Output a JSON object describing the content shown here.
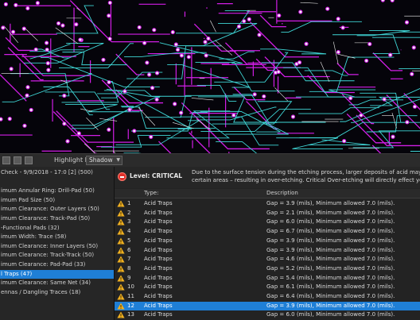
{
  "colors": {
    "accent_selection": "#1f7fd6",
    "critical": "#e0302a",
    "warning": "#f0b020",
    "trace_magenta": "#d21ee6",
    "trace_cyan": "#3fd6d6",
    "trace_white": "#f2f2f2",
    "board_background": "#05040a"
  },
  "pcb_view": {
    "description_icon": "pcb-layout-canvas"
  },
  "toolbar": {
    "icons": [
      "document-icon",
      "grid-icon",
      "list-icon"
    ],
    "highlight_mode_label": "Highlight Mode:",
    "highlight_mode_value": "Shadow"
  },
  "left_panel": {
    "items": [
      {
        "label": "Check - 9/9/2018 - 17:0 [2] (500)",
        "selected": false
      },
      {
        "label": "",
        "selected": false
      },
      {
        "label": "imum Annular Ring: Drill-Pad (50)",
        "selected": false
      },
      {
        "label": "imum Pad Size (50)",
        "selected": false
      },
      {
        "label": "imum Clearance: Outer Layers (50)",
        "selected": false
      },
      {
        "label": "imum Clearance: Track-Pad (50)",
        "selected": false
      },
      {
        "label": "-Functional Pads (32)",
        "selected": false
      },
      {
        "label": "imum Width: Trace (58)",
        "selected": false
      },
      {
        "label": "imum Clearance: Inner Layers (50)",
        "selected": false
      },
      {
        "label": "imum Clearance: Track-Track (50)",
        "selected": false
      },
      {
        "label": "imum Clearance: Pad-Pad (33)",
        "selected": false
      },
      {
        "label": "l Traps (47)",
        "selected": true
      },
      {
        "label": "imum Clearance: Same Net (34)",
        "selected": false
      },
      {
        "label": "ennas / Dangling Traces (18)",
        "selected": false
      }
    ]
  },
  "level": {
    "text": "Level: CRITICAL",
    "description_line1": "Due to the surface tension during the etching process, larger deposits of acid may get",
    "description_line2": "certain areas – resulting in over-etching. Critical   Over-etching will directly effect you"
  },
  "table": {
    "col_type": "Type:",
    "col_desc": "Description",
    "rows": [
      {
        "num": "1",
        "type": "Acid Traps",
        "desc": "Gap = 3.9 (mils), Minimum allowed 7.0 (mils).",
        "selected": false
      },
      {
        "num": "2",
        "type": "Acid Traps",
        "desc": "Gap = 2.1 (mils), Minimum allowed 7.0 (mils).",
        "selected": false
      },
      {
        "num": "3",
        "type": "Acid Traps",
        "desc": "Gap = 6.0 (mils), Minimum allowed 7.0 (mils).",
        "selected": false
      },
      {
        "num": "4",
        "type": "Acid Traps",
        "desc": "Gap = 6.7 (mils), Minimum allowed 7.0 (mils).",
        "selected": false
      },
      {
        "num": "5",
        "type": "Acid Traps",
        "desc": "Gap = 3.9 (mils), Minimum allowed 7.0 (mils).",
        "selected": false
      },
      {
        "num": "6",
        "type": "Acid Traps",
        "desc": "Gap = 3.9 (mils), Minimum allowed 7.0 (mils).",
        "selected": false
      },
      {
        "num": "7",
        "type": "Acid Traps",
        "desc": "Gap = 4.6 (mils), Minimum allowed 7.0 (mils).",
        "selected": false
      },
      {
        "num": "8",
        "type": "Acid Traps",
        "desc": "Gap = 5.2 (mils), Minimum allowed 7.0 (mils).",
        "selected": false
      },
      {
        "num": "9",
        "type": "Acid Traps",
        "desc": "Gap = 5.4 (mils), Minimum allowed 7.0 (mils).",
        "selected": false
      },
      {
        "num": "10",
        "type": "Acid Traps",
        "desc": "Gap = 6.1 (mils), Minimum allowed 7.0 (mils).",
        "selected": false
      },
      {
        "num": "11",
        "type": "Acid Traps",
        "desc": "Gap = 6.4 (mils), Minimum allowed 7.0 (mils).",
        "selected": false
      },
      {
        "num": "12",
        "type": "Acid Traps",
        "desc": "Gap = 3.9 (mils), Minimum allowed 7.0 (mils).",
        "selected": true
      },
      {
        "num": "13",
        "type": "Acid Traps",
        "desc": "Gap = 6.0 (mils), Minimum allowed 7.0 (mils).",
        "selected": false
      }
    ]
  }
}
